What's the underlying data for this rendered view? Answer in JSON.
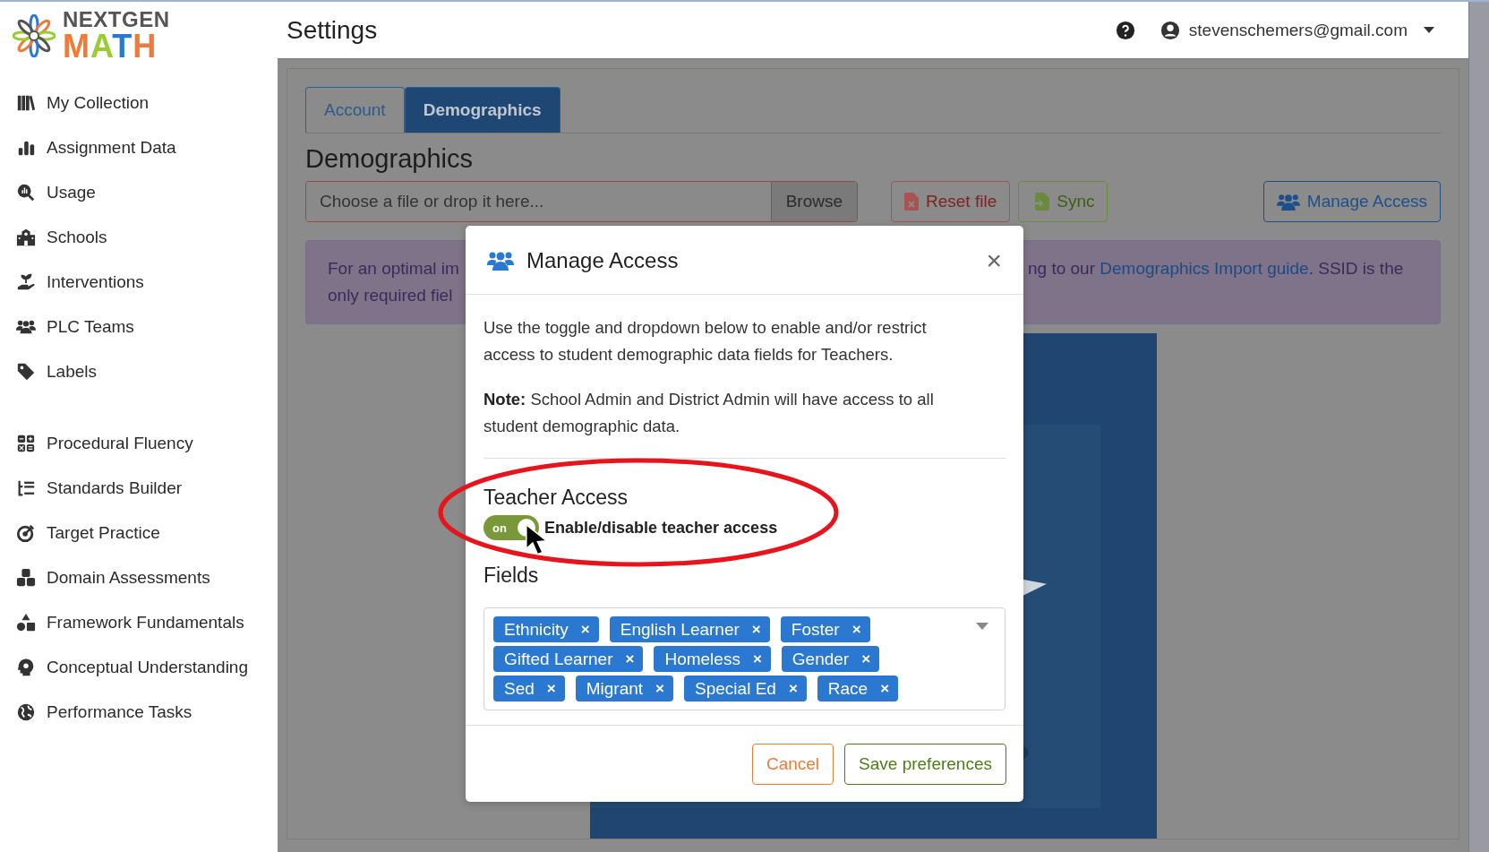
{
  "logo": {
    "top": "NEXTGEN",
    "bottom": "MATH"
  },
  "header": {
    "title": "Settings",
    "user": "stevenschemers@gmail.com"
  },
  "sidebar": {
    "groups": [
      {
        "items": [
          {
            "label": "My Collection"
          },
          {
            "label": "Assignment Data"
          },
          {
            "label": "Usage"
          },
          {
            "label": "Schools"
          },
          {
            "label": "Interventions"
          },
          {
            "label": "PLC Teams"
          },
          {
            "label": "Labels"
          }
        ]
      },
      {
        "items": [
          {
            "label": "Procedural Fluency"
          },
          {
            "label": "Standards Builder"
          },
          {
            "label": "Target Practice"
          },
          {
            "label": "Domain Assessments"
          },
          {
            "label": "Framework Fundamentals"
          },
          {
            "label": "Conceptual Understanding"
          },
          {
            "label": "Performance Tasks"
          }
        ]
      }
    ]
  },
  "tabs": [
    {
      "label": "Account",
      "selected": false
    },
    {
      "label": "Demographics",
      "selected": true
    }
  ],
  "section": {
    "heading": "Demographics",
    "file_field": {
      "placeholder": "Choose a file or drop it here..."
    },
    "browse": "Browse",
    "reset": "Reset file",
    "sync": "Sync",
    "manage": "Manage Access",
    "info": {
      "left_lines": [
        "For an optimal im",
        "only required fiel"
      ],
      "right_before": "ng to our ",
      "right_link": "Demographics Import guide",
      "right_after": ". SSID is the"
    }
  },
  "modal": {
    "title": "Manage Access",
    "close": "×",
    "paragraphs": [
      "Use the toggle and dropdown below to enable and/or restrict access to student demographic data fields for Teachers.",
      "**Note:** School Admin and District Admin will have access to all student demographic data."
    ],
    "teacher_access": {
      "heading": "Teacher Access",
      "toggle": {
        "on": true,
        "text": "on"
      },
      "label": "Enable/disable teacher access"
    },
    "fields": {
      "heading": "Fields",
      "tags": [
        {
          "label": "Ethnicity",
          "remove": "×"
        },
        {
          "label": "English Learner",
          "remove": "×"
        },
        {
          "label": "Foster",
          "remove": "×"
        },
        {
          "label": "Gifted Learner",
          "remove": "×"
        },
        {
          "label": "Homeless",
          "remove": "×"
        },
        {
          "label": "Gender",
          "remove": "×"
        },
        {
          "label": "Sed",
          "remove": "×"
        },
        {
          "label": "Migrant",
          "remove": "×"
        },
        {
          "label": "Special Ed",
          "remove": "×"
        },
        {
          "label": "Race",
          "remove": "×"
        }
      ]
    },
    "buttons": {
      "cancel": "Cancel",
      "save": "Save preferences"
    }
  }
}
